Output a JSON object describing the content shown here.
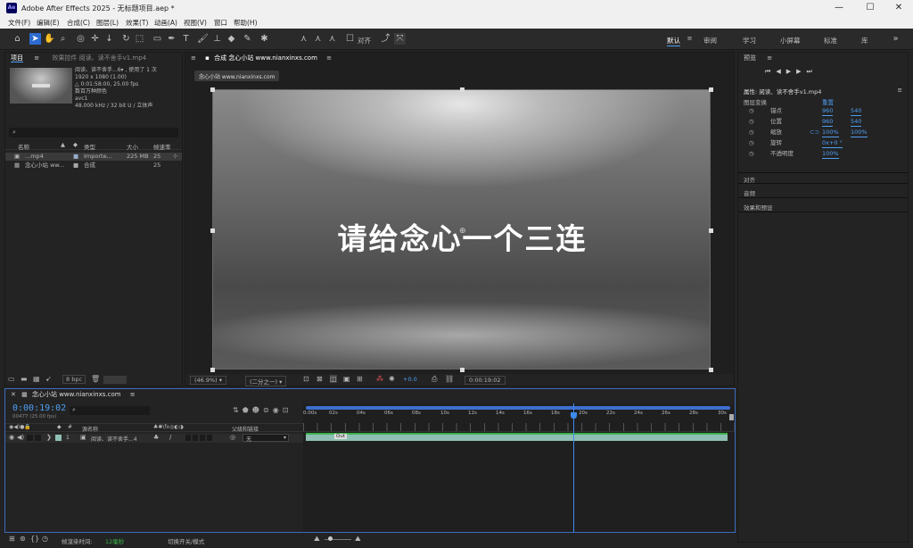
{
  "window": {
    "title": "Adobe After Effects 2025 - 无标题项目.aep *",
    "logo": "Ae",
    "minimize": "—",
    "maximize": "☐",
    "close": "✕"
  },
  "menu": [
    "文件(F)",
    "编辑(E)",
    "合成(C)",
    "图层(L)",
    "效果(T)",
    "动画(A)",
    "视图(V)",
    "窗口",
    "帮助(H)"
  ],
  "toolbar": {
    "align_label": "对齐"
  },
  "workspaces": [
    "默认",
    "审阅",
    "学习",
    "小屏幕",
    "标准",
    "库"
  ],
  "project": {
    "tab": "项目",
    "effects_tab": "效果控件 阅读、读不舍手v1.mp4",
    "info": [
      "阅读、读不舍手...6▾ , 使用了 1 次",
      "1920 x 1080 (1.00)",
      "△ 0:01:58:00, 25.00 fps",
      "数百万种颜色",
      "avc1",
      "48.000 kHz / 32 bit U / 立体声"
    ],
    "search_icon": "⌕",
    "columns": [
      "名称",
      "类型",
      "大小",
      "帧速率"
    ],
    "items": [
      {
        "name": "...mp4",
        "type": "Importe...",
        "size": "225 MB",
        "fps": "25"
      },
      {
        "name": "念心小站 ww...",
        "type": "合成",
        "size": "",
        "fps": "25"
      }
    ],
    "bpc": "8 bpc"
  },
  "composition": {
    "tab": "合成 念心小站 www.nianxinxs.com",
    "subtab": "念心小站 www.nianxinxs.com",
    "text": "请给念心一个三连",
    "zoom": "(46.9%)",
    "resolution": "(二分之一)",
    "exposure": "+0.0",
    "timecode": "0:00:19:02"
  },
  "right": {
    "preview_tab": "预览",
    "props_title": "属性: 阅读、读不舍手v1.mp4",
    "layer_transform": "图层变换",
    "reset": "重置",
    "props": [
      {
        "name": "锚点",
        "v1": "960",
        "v2": "540"
      },
      {
        "name": "位置",
        "v1": "960",
        "v2": "540"
      },
      {
        "name": "缩放",
        "v1": "100%",
        "v2": "100%"
      },
      {
        "name": "旋转",
        "v1": "0x+0 °",
        "v2": ""
      },
      {
        "name": "不透明度",
        "v1": "100%",
        "v2": ""
      }
    ],
    "sections": [
      "对齐",
      "音频",
      "效果和预设"
    ]
  },
  "timeline": {
    "tab": "念心小站 www.nianxinxs.com",
    "timecode": "0:00:19:02",
    "frames": "00477 (25.00 fps)",
    "col_source": "源名称",
    "col_parent": "父级和链接",
    "layer_num": "1",
    "layer_name": "阅读、读不舍手...4",
    "parent_value": "无",
    "ticks": [
      "0:00s",
      "02s",
      "04s",
      "06s",
      "08s",
      "10s",
      "12s",
      "14s",
      "16s",
      "18s",
      "20s",
      "22s",
      "24s",
      "26s",
      "28s",
      "30s"
    ],
    "marker_label": "Out",
    "playhead_fraction": 0.635
  },
  "status": {
    "render_label": "帧渲染时间:",
    "render_value": "12毫秒",
    "toggle": "切换开关/模式"
  },
  "colors": {
    "accent": "#4e9ff5",
    "bar": "#8fbfb4",
    "bar_top": "#3ab54a"
  }
}
